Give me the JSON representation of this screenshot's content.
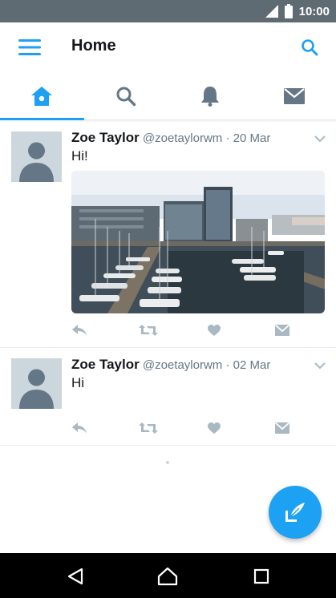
{
  "status_bar": {
    "time": "10:00"
  },
  "app_bar": {
    "title": "Home"
  },
  "tabs": [
    {
      "name": "home",
      "active": true
    },
    {
      "name": "search",
      "active": false
    },
    {
      "name": "notifications",
      "active": false
    },
    {
      "name": "messages",
      "active": false
    }
  ],
  "tweets": [
    {
      "name": "Zoe Taylor",
      "handle": "@zoetaylorwm",
      "separator": "·",
      "date": "20 Mar",
      "text": "Hi!",
      "has_image": true
    },
    {
      "name": "Zoe Taylor",
      "handle": "@zoetaylorwm",
      "separator": "·",
      "date": "02 Mar",
      "text": "Hi",
      "has_image": false
    }
  ],
  "colors": {
    "accent": "#1da1f2",
    "status_bar": "#5f6b73",
    "action_icons": "#aab8c2",
    "nav_bar": "#000000"
  },
  "icons": [
    "menu-icon",
    "search-icon",
    "home-icon",
    "bell-icon",
    "mail-icon",
    "reply-icon",
    "retweet-icon",
    "like-icon",
    "direct-message-icon",
    "compose-icon",
    "back-icon",
    "home-nav-icon",
    "recents-icon"
  ]
}
